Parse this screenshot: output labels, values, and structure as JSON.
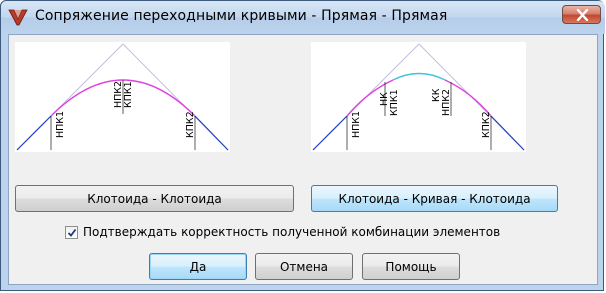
{
  "window": {
    "title": "Сопряжение переходными кривыми - Прямая - Прямая",
    "close_icon": "close-icon",
    "app_icon": "app-logo-icon"
  },
  "diagram_left": {
    "labels": [
      "НПК1",
      "НПК2",
      "КПК1",
      "КПК2"
    ]
  },
  "diagram_right": {
    "labels": [
      "НПК1",
      "НК",
      "КПК1",
      "КК",
      "НПК2",
      "КПК2"
    ]
  },
  "buttons": {
    "clothoid_clothoid": "Клотоида - Клотоида",
    "clothoid_curve_clothoid": "Клотоида - Кривая - Клотоида",
    "ok": "Да",
    "cancel": "Отмена",
    "help": "Помощь"
  },
  "checkbox": {
    "label": "Подтверждать корректность полученной комбинации элементов",
    "checked": true
  },
  "colors": {
    "clothoid": "#e040e0",
    "arc": "#40c0e0",
    "tangent": "#2040c0",
    "construction": "#b8b8d8"
  }
}
